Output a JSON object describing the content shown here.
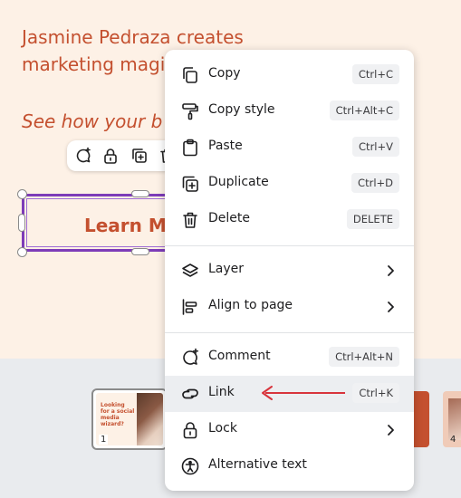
{
  "canvas": {
    "headline": "Jasmine Pedraza creates marketing magi",
    "subline": "See how your b",
    "button_text": "Learn Mo",
    "text_color": "#c4502f",
    "background_color": "#fdf1e6",
    "selection_color": "#7d3cb8"
  },
  "floating_toolbar": {
    "icons": [
      "comment-add-icon",
      "lock-icon",
      "duplicate-icon",
      "trash-icon"
    ]
  },
  "context_menu": {
    "items": [
      {
        "label": "Copy",
        "shortcut": "Ctrl+C",
        "icon": "copy-icon"
      },
      {
        "label": "Copy style",
        "shortcut": "Ctrl+Alt+C",
        "icon": "paint-roller-icon"
      },
      {
        "label": "Paste",
        "shortcut": "Ctrl+V",
        "icon": "clipboard-icon"
      },
      {
        "label": "Duplicate",
        "shortcut": "Ctrl+D",
        "icon": "duplicate-icon"
      },
      {
        "label": "Delete",
        "shortcut": "DELETE",
        "icon": "trash-icon"
      },
      {
        "label": "Layer",
        "icon": "layers-icon",
        "submenu": true
      },
      {
        "label": "Align to page",
        "icon": "align-left-icon",
        "submenu": true
      },
      {
        "label": "Comment",
        "shortcut": "Ctrl+Alt+N",
        "icon": "comment-add-icon"
      },
      {
        "label": "Link",
        "shortcut": "Ctrl+K",
        "icon": "link-icon",
        "highlighted": true
      },
      {
        "label": "Lock",
        "icon": "lock-icon",
        "submenu": true
      },
      {
        "label": "Alternative text",
        "icon": "accessibility-icon"
      }
    ]
  },
  "annotation": {
    "arrow_color": "#d8343c",
    "points_to": "Link"
  },
  "page_strip": {
    "thumbnails": [
      {
        "number": "1",
        "text": "Looking for a social media wizard?",
        "selected": true
      },
      {
        "number": "4"
      }
    ]
  }
}
